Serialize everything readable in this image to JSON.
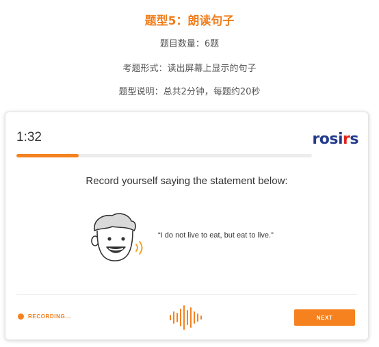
{
  "header": {
    "title": "题型5：朗读句子",
    "count_line": "题目数量：6题",
    "format_line": "考题形式：读出屏幕上显示的句子",
    "desc_line": "题型说明：总共2分钟，每题约20秒"
  },
  "card": {
    "timer": "1:32",
    "logo": {
      "main": "rosi",
      "accent": "r",
      "tail": "s"
    },
    "progress": 0.21,
    "instruction": "Record yourself saying the statement below:",
    "quote": "“I do not live to eat, but eat to live.”",
    "recording_label": "RECORDING...",
    "next_label": "NEXT"
  },
  "colors": {
    "accent": "#f5821f",
    "logo_blue": "#233a8c",
    "logo_red": "#e2231a"
  },
  "icons": [
    "speaking-face-icon",
    "recording-dot-icon",
    "sound-wave-icon"
  ]
}
